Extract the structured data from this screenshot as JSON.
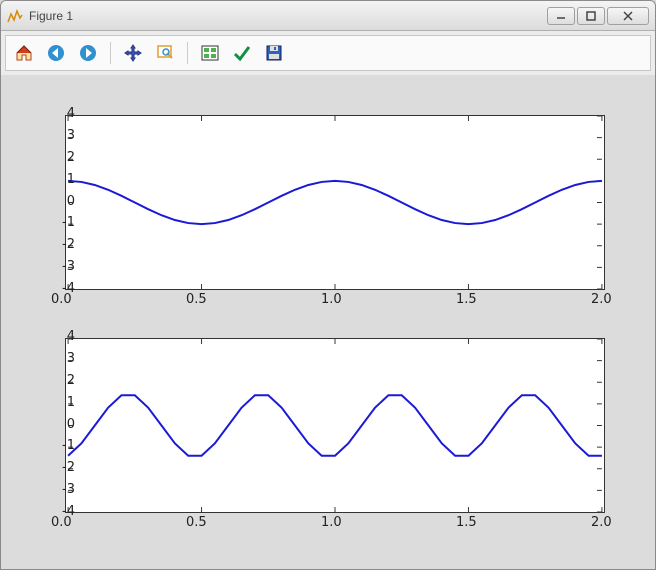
{
  "window": {
    "title": "Figure 1"
  },
  "toolbar": {
    "home": "home-icon",
    "back": "back-icon",
    "forward": "forward-icon",
    "pan": "pan-icon",
    "zoom": "zoom-icon",
    "subplots": "subplots-icon",
    "customize": "customize-icon",
    "save": "save-icon"
  },
  "chart_data": [
    {
      "type": "line",
      "x": [
        0.0,
        0.05,
        0.1,
        0.15,
        0.2,
        0.25,
        0.3,
        0.35,
        0.4,
        0.45,
        0.5,
        0.55,
        0.6,
        0.65,
        0.7,
        0.75,
        0.8,
        0.85,
        0.9,
        0.95,
        1.0,
        1.05,
        1.1,
        1.15,
        1.2,
        1.25,
        1.3,
        1.35,
        1.4,
        1.45,
        1.5,
        1.55,
        1.6,
        1.65,
        1.7,
        1.75,
        1.8,
        1.85,
        1.9,
        1.95,
        2.0
      ],
      "values": [
        1.0,
        0.951,
        0.809,
        0.588,
        0.309,
        0.0,
        -0.309,
        -0.588,
        -0.809,
        -0.951,
        -1.0,
        -0.951,
        -0.809,
        -0.588,
        -0.309,
        0.0,
        0.309,
        0.588,
        0.809,
        0.951,
        1.0,
        0.951,
        0.809,
        0.588,
        0.309,
        0.0,
        -0.309,
        -0.588,
        -0.809,
        -0.951,
        -1.0,
        -0.951,
        -0.809,
        -0.588,
        -0.309,
        0.0,
        0.309,
        0.588,
        0.809,
        0.951,
        1.0
      ],
      "xlim": [
        0.0,
        2.0
      ],
      "ylim": [
        -4,
        4
      ],
      "xticks": [
        "0.0",
        "0.5",
        "1.0",
        "1.5",
        "2.0"
      ],
      "yticks": [
        "-4",
        "-3",
        "-2",
        "-1",
        "0",
        "1",
        "2",
        "3",
        "4"
      ],
      "title": "",
      "xlabel": "",
      "ylabel": ""
    },
    {
      "type": "line",
      "x": [
        0.0,
        0.05,
        0.1,
        0.15,
        0.2,
        0.25,
        0.3,
        0.35,
        0.4,
        0.45,
        0.5,
        0.55,
        0.6,
        0.65,
        0.7,
        0.75,
        0.8,
        0.85,
        0.9,
        0.95,
        1.0,
        1.05,
        1.1,
        1.15,
        1.2,
        1.25,
        1.3,
        1.35,
        1.4,
        1.45,
        1.5,
        1.55,
        1.6,
        1.65,
        1.7,
        1.75,
        1.8,
        1.85,
        1.9,
        1.95,
        2.0
      ],
      "values": [
        -1.4,
        -0.825,
        0.0,
        0.825,
        1.4,
        1.4,
        0.825,
        0.0,
        -0.825,
        -1.4,
        -1.4,
        -0.825,
        0.0,
        0.825,
        1.4,
        1.4,
        0.825,
        0.0,
        -0.825,
        -1.4,
        -1.4,
        -0.825,
        0.0,
        0.825,
        1.4,
        1.4,
        0.825,
        0.0,
        -0.825,
        -1.4,
        -1.4,
        -0.825,
        0.0,
        0.825,
        1.4,
        1.4,
        0.825,
        0.0,
        -0.825,
        -1.4,
        -1.4
      ],
      "xlim": [
        0.0,
        2.0
      ],
      "ylim": [
        -4,
        4
      ],
      "xticks": [
        "0.0",
        "0.5",
        "1.0",
        "1.5",
        "2.0"
      ],
      "yticks": [
        "-4",
        "-3",
        "-2",
        "-1",
        "0",
        "1",
        "2",
        "3",
        "4"
      ],
      "title": "",
      "xlabel": "",
      "ylabel": ""
    }
  ]
}
